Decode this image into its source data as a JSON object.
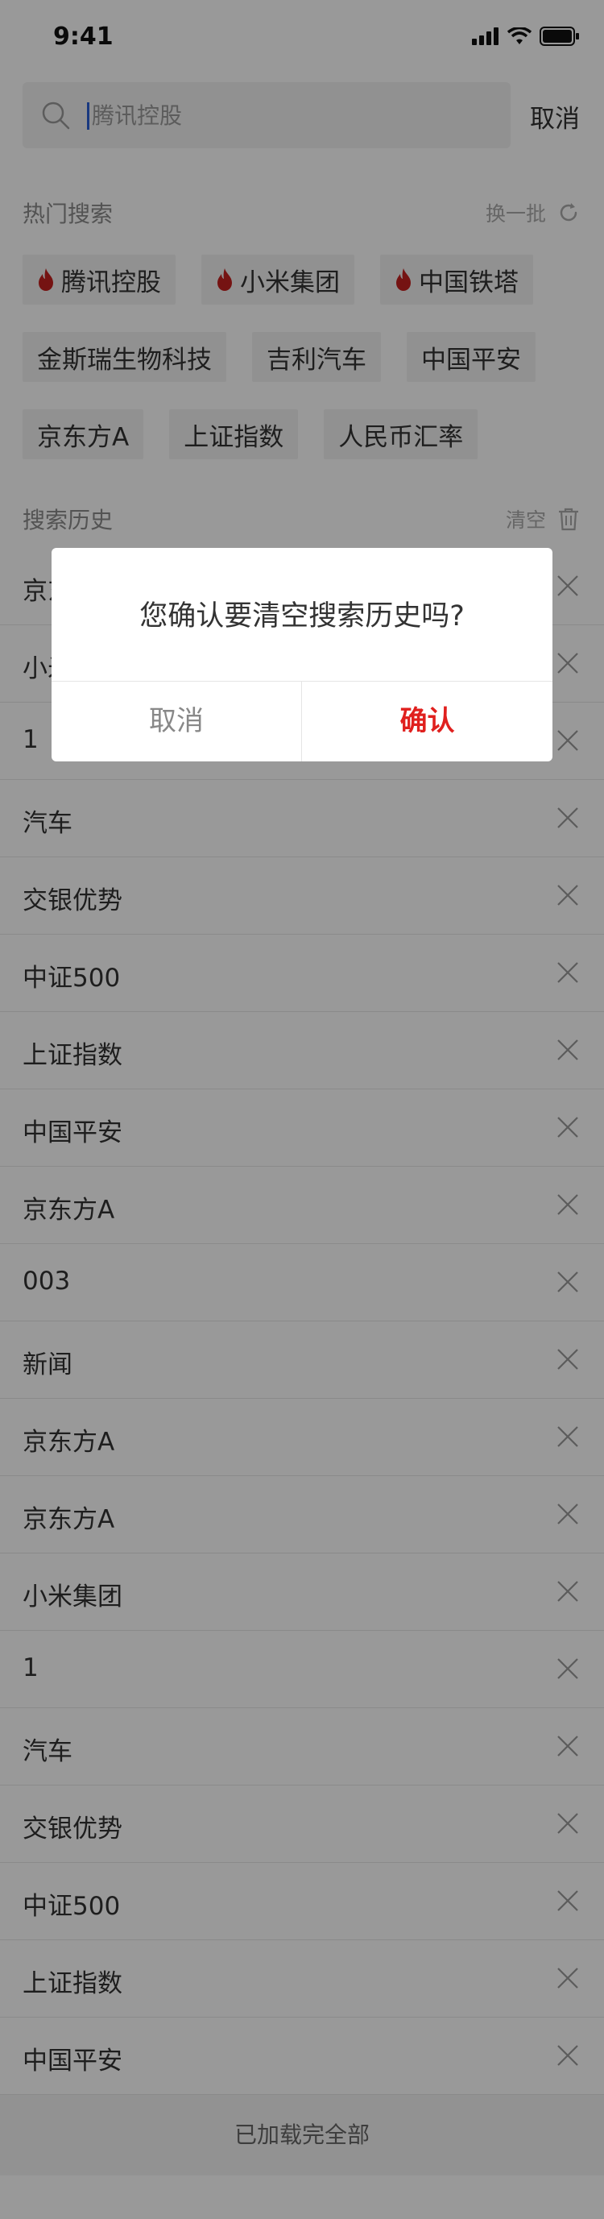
{
  "status_bar": {
    "time": "9:41"
  },
  "search": {
    "placeholder": "腾讯控股",
    "value": "",
    "cancel_label": "取消"
  },
  "hot": {
    "title": "热门搜索",
    "refresh_label": "换一批",
    "rows": [
      [
        {
          "label": "腾讯控股",
          "hot": true
        },
        {
          "label": "小米集团",
          "hot": true
        },
        {
          "label": "中国铁塔",
          "hot": true
        }
      ],
      [
        {
          "label": "金斯瑞生物科技",
          "hot": false
        },
        {
          "label": "吉利汽车",
          "hot": false
        },
        {
          "label": "中国平安",
          "hot": false
        }
      ],
      [
        {
          "label": "京东方A",
          "hot": false
        },
        {
          "label": "上证指数",
          "hot": false
        },
        {
          "label": "人民币汇率",
          "hot": false
        }
      ]
    ]
  },
  "history": {
    "title": "搜索历史",
    "clear_label": "清空",
    "items": [
      "京东方A",
      "小米集团",
      "1",
      "汽车",
      "交银优势",
      "中证500",
      "上证指数",
      "中国平安",
      "京东方A",
      "003",
      "新闻",
      "京东方A",
      "京东方A",
      "小米集团",
      "1",
      "汽车",
      "交银优势",
      "中证500",
      "上证指数",
      "中国平安"
    ]
  },
  "footer": {
    "text": "已加载完全部"
  },
  "dialog": {
    "message": "您确认要清空搜索历史吗?",
    "cancel_label": "取消",
    "confirm_label": "确认"
  },
  "colors": {
    "accent": "#e0201e",
    "flame": "#c4211e",
    "caret": "#2a5fd6"
  },
  "icons": [
    "search-icon",
    "refresh-icon",
    "trash-icon",
    "close-icon",
    "flame-icon",
    "signal-icon",
    "wifi-icon",
    "battery-icon"
  ]
}
